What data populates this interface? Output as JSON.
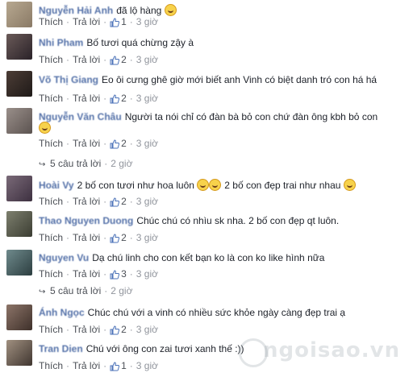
{
  "labels": {
    "like": "Thích",
    "reply": "Trả lời",
    "sep": "·"
  },
  "comments": [
    {
      "name": "Nguyễn Hải Anh",
      "text": "đã lộ hàng",
      "emoji_inline": true,
      "likes": "1",
      "time": "3 giờ",
      "avatar": [
        "#b7a890",
        "#8a7a66"
      ]
    },
    {
      "name": "Nhi Pham",
      "text": "Bố tươi quá chừng zậy à",
      "likes": "2",
      "time": "3 giờ",
      "avatar": [
        "#6a5a58",
        "#2a2228"
      ]
    },
    {
      "name": "Võ Thị Giang",
      "text": "Eo ôi cưng ghê giờ mới biết anh Vinh có biệt danh tró con há há",
      "likes": "2",
      "time": "3 giờ",
      "avatar": [
        "#4c3d36",
        "#1f1a18"
      ]
    },
    {
      "name": "Nguyễn Văn Châu",
      "text": "Người ta nói chỉ có đàn bà bỏ con chứ đàn ông kbh bỏ con",
      "likes": "2",
      "time": "3 giờ",
      "avatar": [
        "#9a8f8a",
        "#5b5350"
      ],
      "replies": {
        "text": "5 câu trả lời",
        "time": "2 giờ"
      }
    },
    {
      "name": "Hoài Vy",
      "text": "2 bố con tươi như hoa luôn",
      "text2": "2 bố con đẹp trai như nhau",
      "likes": "2",
      "time": "3 giờ",
      "avatar": [
        "#7a6a78",
        "#3d3040"
      ]
    },
    {
      "name": "Thao Nguyen Duong",
      "text": "Chúc chú có nhìu sk nha. 2 bố con đẹp qt luôn.",
      "likes": "2",
      "time": "3 giờ",
      "avatar": [
        "#7d7f6e",
        "#3b3d32"
      ]
    },
    {
      "name": "Nguyen Vu",
      "text": "Dạ chú linh cho con kết bạn ko là con ko like hình nữa",
      "likes": "3",
      "time": "3 giờ",
      "avatar": [
        "#6f8a8c",
        "#2c3e40"
      ],
      "replies": {
        "text": "5 câu trả lời",
        "time": "2 giờ"
      }
    },
    {
      "name": "Ánh Ngọc",
      "text": "Chúc chú với a vinh có nhiều sức khỏe ngày càng đẹp trai ạ",
      "likes": "2",
      "time": "3 giờ",
      "avatar": [
        "#8c7468",
        "#3e302a"
      ]
    },
    {
      "name": "Tran Dien",
      "text": "Chú với ông con zai tươi xanh thế :))",
      "likes": "1",
      "time": "3 giờ",
      "avatar": [
        "#a09080",
        "#403630"
      ]
    }
  ],
  "watermark": "ngoisao.vn"
}
